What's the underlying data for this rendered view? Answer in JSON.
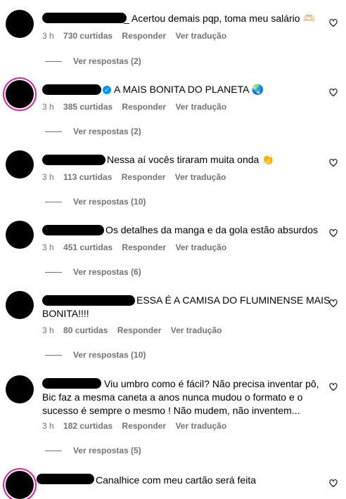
{
  "comments": [
    {
      "text": "_ Acertou demais pqp, toma meu salário 🫶🏻",
      "time": "3 h",
      "likes": "730 curtidas",
      "reply": "Responder",
      "translate": "Ver tradução",
      "replies": "Ver respostas (2)"
    },
    {
      "text": "A MAIS BONITA DO PLANETA 🌏",
      "time": "3 h",
      "likes": "385 curtidas",
      "reply": "Responder",
      "translate": "Ver tradução",
      "replies": "Ver respostas (2)"
    },
    {
      "text": "Nessa aí vocês tiraram muita onda 👏",
      "time": "3 h",
      "likes": "113 curtidas",
      "reply": "Responder",
      "translate": "Ver tradução",
      "replies": "Ver respostas (10)"
    },
    {
      "text": "Os detalhes da manga e da gola estão absurdos",
      "time": "3 h",
      "likes": "451 curtidas",
      "reply": "Responder",
      "translate": "Ver tradução",
      "replies": "Ver respostas (6)"
    },
    {
      "text_line1": "ESSA É A CAMISA DO FLUMINENSE MAIS",
      "text_line2": "BONITA!!!!",
      "time": "3 h",
      "likes": "80 curtidas",
      "reply": "Responder",
      "translate": "Ver tradução",
      "replies": "Ver respostas (10)"
    },
    {
      "text_line1": "Viu umbro como é fácil? Não precisa inventar pô,",
      "text_line2": "Bic faz a mesma caneta a anos nunca mudou o formato e o",
      "text_line3": "sucesso é sempre o mesmo ! Não mudem, não inventem...",
      "time": "3 h",
      "likes": "182 curtidas",
      "reply": "Responder",
      "translate": "Ver tradução",
      "replies": "Ver respostas (5)"
    },
    {
      "text": "Canalhice com meu cartão será feita"
    }
  ]
}
